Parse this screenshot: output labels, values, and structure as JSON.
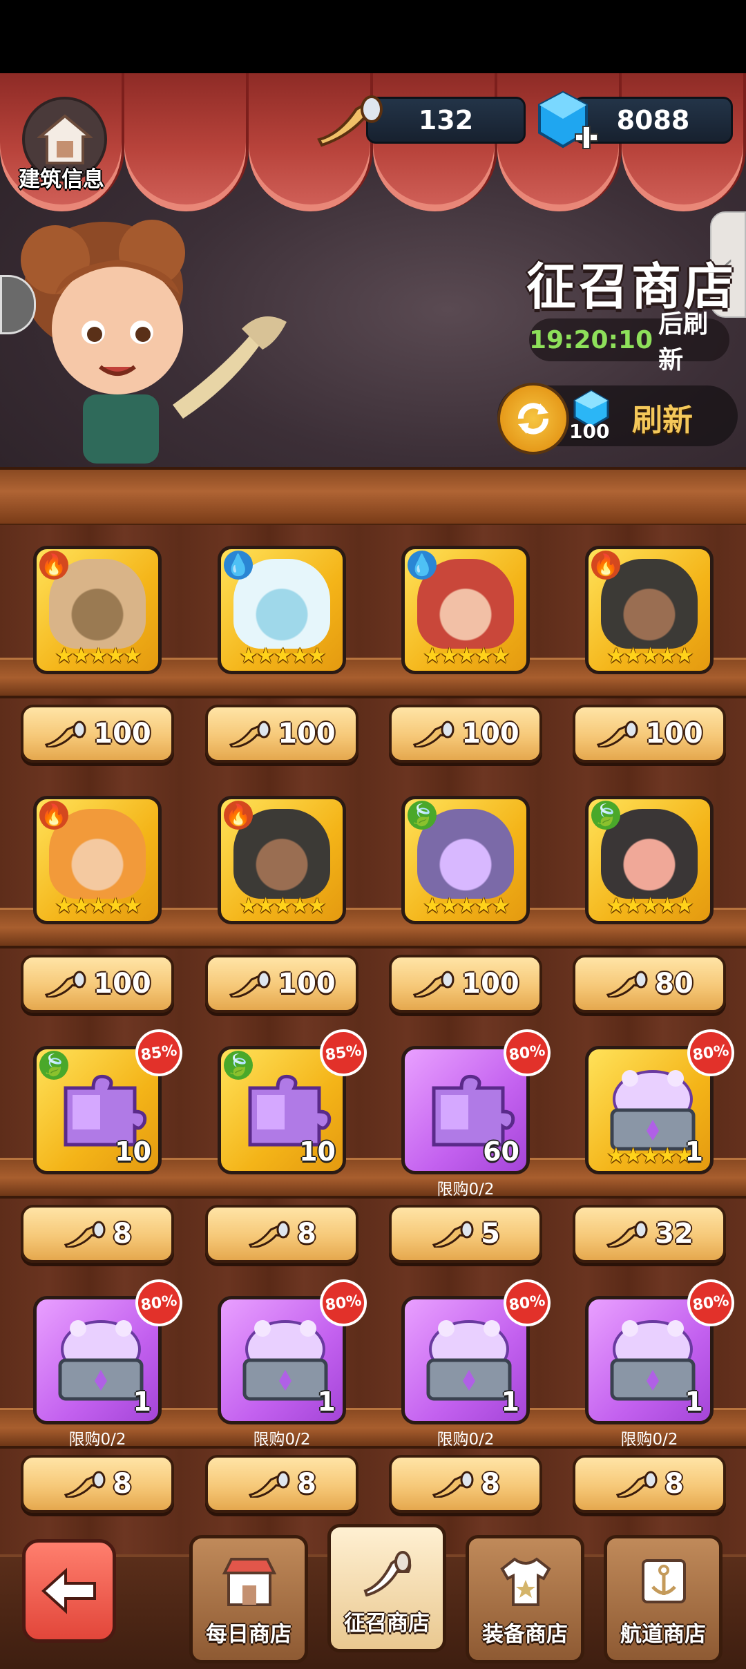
{
  "header": {
    "home_label": "建筑信息",
    "horn_currency": "132",
    "gem_currency": "8088",
    "shop_title": "征召商店",
    "timer_value": "19:20:10",
    "timer_suffix": "后刷新",
    "refresh_cost": "100",
    "refresh_label": "刷新"
  },
  "items": [
    {
      "type": "hero",
      "frame": "gold",
      "element": "fire",
      "portrait": "tan",
      "stars": "★★★★★",
      "price": "100"
    },
    {
      "type": "hero",
      "frame": "gold",
      "element": "water",
      "portrait": "ice",
      "stars": "★★★★★",
      "price": "100"
    },
    {
      "type": "hero",
      "frame": "gold",
      "element": "water",
      "portrait": "red",
      "stars": "★★★★★",
      "price": "100"
    },
    {
      "type": "hero",
      "frame": "gold",
      "element": "fire",
      "portrait": "dark",
      "stars": "★★★★★",
      "price": "100"
    },
    {
      "type": "hero",
      "frame": "gold",
      "element": "fire",
      "portrait": "orange",
      "stars": "★★★★★",
      "price": "100"
    },
    {
      "type": "hero",
      "frame": "gold",
      "element": "fire",
      "portrait": "dark",
      "stars": "★★★★★",
      "price": "100"
    },
    {
      "type": "hero",
      "frame": "gold",
      "element": "leaf",
      "portrait": "violet",
      "stars": "★★★★★",
      "price": "100"
    },
    {
      "type": "hero",
      "frame": "gold",
      "element": "leaf",
      "portrait": "pink",
      "stars": "★★★★★",
      "price": "80"
    },
    {
      "type": "shard",
      "frame": "gold",
      "element": "leaf",
      "count": "10",
      "badge": "85%",
      "price": "8"
    },
    {
      "type": "shard",
      "frame": "gold",
      "element": "leaf",
      "count": "10",
      "badge": "85%",
      "price": "8"
    },
    {
      "type": "shard",
      "frame": "purple",
      "count": "60",
      "badge": "80%",
      "limit": "限购0/2",
      "price": "5"
    },
    {
      "type": "chest",
      "frame": "gold",
      "count": "1",
      "badge": "80%",
      "stars": "★★★★★",
      "price": "32"
    },
    {
      "type": "chest",
      "frame": "purple",
      "count": "1",
      "badge": "80%",
      "limit": "限购0/2",
      "price": "8"
    },
    {
      "type": "chest",
      "frame": "purple",
      "count": "1",
      "badge": "80%",
      "limit": "限购0/2",
      "price": "8"
    },
    {
      "type": "chest",
      "frame": "purple",
      "count": "1",
      "badge": "80%",
      "limit": "限购0/2",
      "price": "8"
    },
    {
      "type": "chest",
      "frame": "purple",
      "count": "1",
      "badge": "80%",
      "limit": "限购0/2",
      "price": "8"
    }
  ],
  "tabs": [
    {
      "label": "每日商店",
      "icon": "shop-stall-icon",
      "active": false
    },
    {
      "label": "征召商店",
      "icon": "horn-icon",
      "active": true
    },
    {
      "label": "装备商店",
      "icon": "shirt-icon",
      "active": false
    },
    {
      "label": "航道商店",
      "icon": "anchor-icon",
      "active": false
    }
  ],
  "colors": {
    "accent_gold": "#f4b418",
    "accent_purple": "#c361ef",
    "badge_red": "#e2312a",
    "timer_green": "#8ee05a"
  }
}
